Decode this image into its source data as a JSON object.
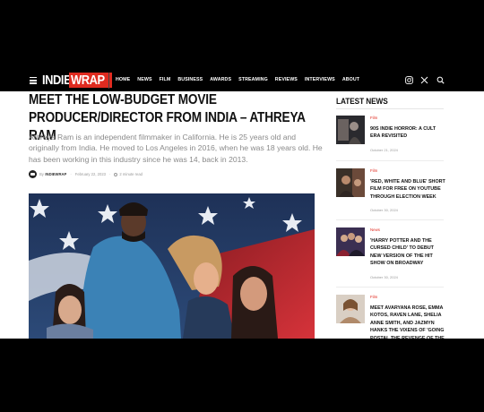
{
  "nav": {
    "logo": {
      "part1": "INDIE",
      "part2": "WRAP"
    },
    "menu": [
      "HOME",
      "NEWS",
      "FILM",
      "BUSINESS",
      "AWARDS",
      "STREAMING",
      "REVIEWS",
      "INTERVIEWS",
      "ABOUT"
    ]
  },
  "article": {
    "title": "MEET THE LOW-BUDGET MOVIE PRODUCER/DIRECTOR FROM INDIA – ATHREYA RAM",
    "excerpt": "Athreya Ram is an independent filmmaker in California. He is 25 years old and originally from India. He moved to Los Angeles in 2016, when he was 18 years old. He has been working in this industry since he was 14, back in 2013.",
    "by": "By",
    "author": "INDIEWRAP",
    "date": "February 22, 2023",
    "read_time": "2 minute read"
  },
  "sidebar": {
    "title": "LATEST NEWS",
    "items": [
      {
        "category": "Film",
        "title": "90s Indie Horror: A Cult Era Revisited",
        "date": "October 21, 2024"
      },
      {
        "category": "Film",
        "title": "'Red, White and Blue' Short Film for Free on YouTube Through Election Week",
        "date": "October 30, 2024"
      },
      {
        "category": "News",
        "title": "'Harry Potter and the Cursed Child' to Debut New Version of the Hit Show on Broadway",
        "date": "October 30, 2024"
      },
      {
        "category": "Film",
        "title": "Meet Avaryana Rose, Emma Kotos, Raven Lane, Shelia Anne Smith, and Jazmyn Hanks the Vixens of 'Going Postal the Revenge of the",
        "date": ""
      }
    ]
  },
  "colors": {
    "accent": "#e02b20",
    "nav_bg": "#000000",
    "page_bg": "#ffffff"
  }
}
